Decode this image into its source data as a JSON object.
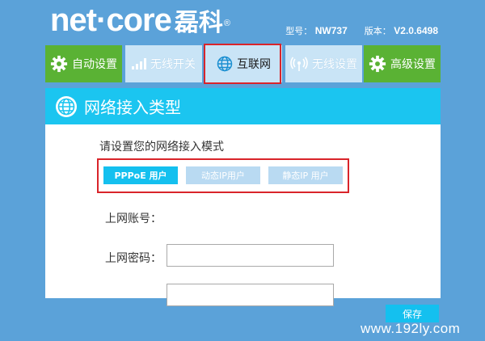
{
  "brand": {
    "name_en_left": "net",
    "name_en_right": "core",
    "name_cn": "磊科",
    "reg": "®"
  },
  "model": {
    "model_label": "型号：",
    "model_value": "NW737",
    "version_label": "版本：",
    "version_value": "V2.0.6498"
  },
  "nav": {
    "tabs": [
      {
        "label": "自动设置",
        "icon": "gear-icon"
      },
      {
        "label": "无线开关",
        "icon": "signal-bars-icon"
      },
      {
        "label": "互联网",
        "icon": "globe-icon"
      },
      {
        "label": "无线设置",
        "icon": "wireless-icon"
      },
      {
        "label": "高级设置",
        "icon": "gear-icon"
      }
    ],
    "active_tab": "互联网"
  },
  "panel": {
    "title": "网络接入类型",
    "prompt": "请设置您的网络接入模式",
    "modes": [
      {
        "label": "PPPoE 用户",
        "selected": true
      },
      {
        "label": "动态IP用户",
        "selected": false
      },
      {
        "label": "静态IP 用户",
        "selected": false
      }
    ],
    "account_label": "上网账号：",
    "account_value": "",
    "password_label": "上网密码：",
    "password_value": ""
  },
  "actions": {
    "save_label": "保存"
  },
  "watermark": "www.192ly.com",
  "colors": {
    "background": "#5ba2d9",
    "green_tab": "#5ab234",
    "accent": "#14c0ef",
    "highlight": "#d9242a"
  }
}
